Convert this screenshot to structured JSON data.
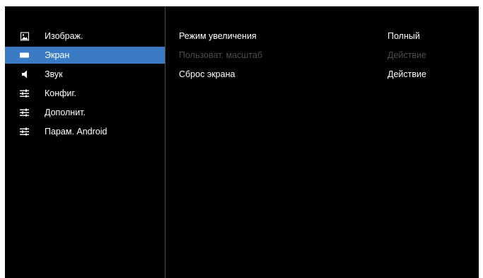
{
  "colors": {
    "background": "#000000",
    "selected": "#3a7bc4",
    "text": "#ffffff",
    "disabled_text": "#4d4d4d"
  },
  "sidebar": {
    "items": [
      {
        "label": "Изображ.",
        "icon": "picture-icon",
        "selected": false
      },
      {
        "label": "Экран",
        "icon": "screen-icon",
        "selected": true
      },
      {
        "label": "Звук",
        "icon": "speaker-icon",
        "selected": false
      },
      {
        "label": "Конфиг.",
        "icon": "sliders-icon",
        "selected": false
      },
      {
        "label": "Дополнит.",
        "icon": "sliders-icon",
        "selected": false
      },
      {
        "label": "Парам. Android",
        "icon": "sliders-icon",
        "selected": false
      }
    ]
  },
  "main": {
    "rows": [
      {
        "label": "Режим увеличения",
        "value": "Полный",
        "enabled": true
      },
      {
        "label": "Пользоват. масштаб",
        "value": "Действие",
        "enabled": false
      },
      {
        "label": "Сброс экрана",
        "value": "Действие",
        "enabled": true
      }
    ]
  }
}
